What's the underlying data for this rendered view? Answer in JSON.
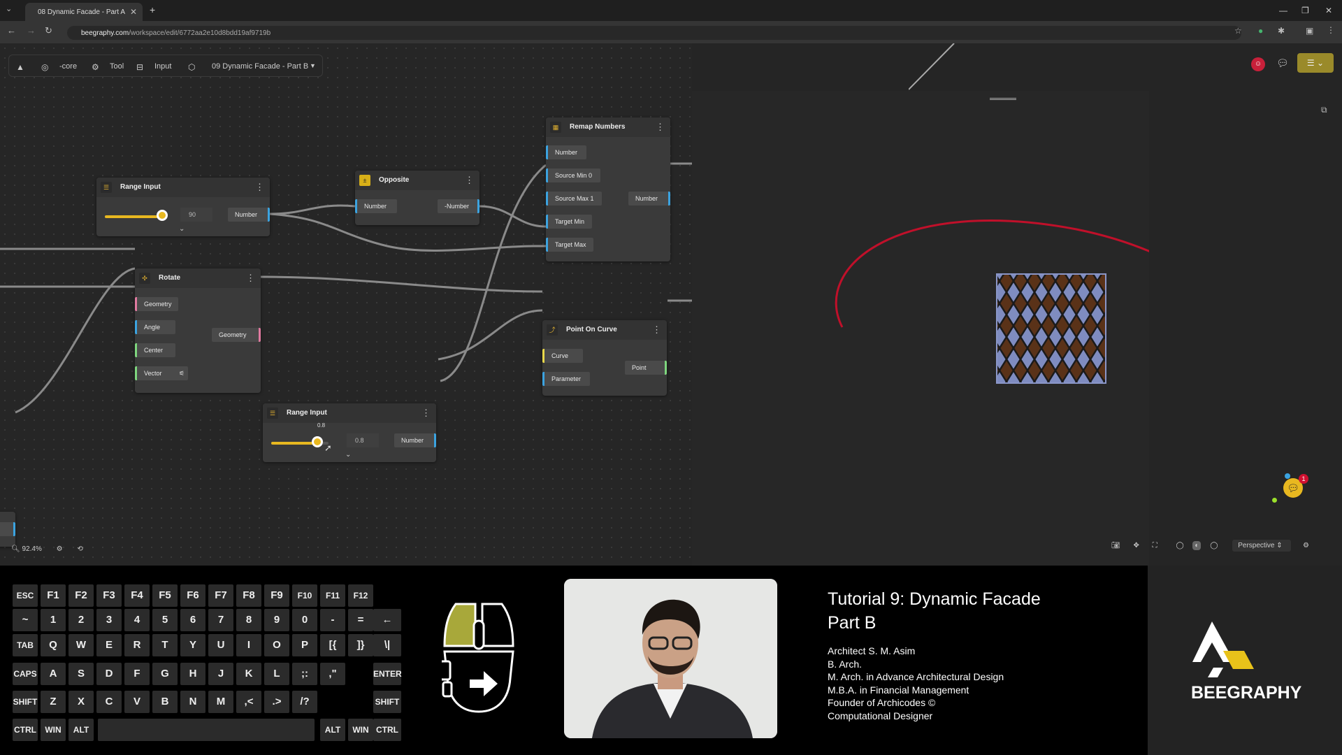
{
  "browser": {
    "tab_title": "08 Dynamic Facade - Part A",
    "url_host": "beegraphy.com",
    "url_path": "/workspace/edit/6772aa2e10d8bdd19af9719b"
  },
  "toolbar": {
    "core_label": "-core",
    "tool_label": "Tool",
    "input_label": "Input",
    "project_label": "09 Dynamic Facade - Part B"
  },
  "nodes": {
    "range_input_1": {
      "title": "Range Input",
      "value": "90",
      "output": "Number"
    },
    "opposite": {
      "title": "Opposite",
      "input": "Number",
      "output": "-Number"
    },
    "remap": {
      "title": "Remap Numbers",
      "inputs": [
        "Number",
        "Source Min",
        "Source Max",
        "Target Min",
        "Target Max"
      ],
      "source_min_val": "0",
      "source_max_val": "1",
      "output": "Number"
    },
    "rotate": {
      "title": "Rotate",
      "inputs": [
        "Geometry",
        "Angle",
        "Center",
        "Vector"
      ],
      "output": "Geometry"
    },
    "point_on_curve": {
      "title": "Point On Curve",
      "inputs": [
        "Curve",
        "Parameter"
      ],
      "output": "Point"
    },
    "range_input_2": {
      "title": "Range Input",
      "tooltip": "0.8",
      "value": "0.8",
      "output": "Number"
    },
    "partial_left": {
      "label": "ber"
    }
  },
  "slider_levels": {
    "range_input_1": 1.0,
    "range_input_2": 0.8
  },
  "zoom": "92.4%",
  "viewport": {
    "view_mode": "Perspective",
    "notification_count": "1"
  },
  "keyboard": {
    "rows": [
      [
        "ESC",
        "F1",
        "F2",
        "F3",
        "F4",
        "F5",
        "F6",
        "F7",
        "F8",
        "F9",
        "F10",
        "F11",
        "F12"
      ],
      [
        "~",
        "1",
        "2",
        "3",
        "4",
        "5",
        "6",
        "7",
        "8",
        "9",
        "0",
        "-",
        "=",
        "←"
      ],
      [
        "TAB",
        "Q",
        "W",
        "E",
        "R",
        "T",
        "Y",
        "U",
        "I",
        "O",
        "P",
        "[{",
        "]}",
        "\\|"
      ],
      [
        "CAPS",
        "A",
        "S",
        "D",
        "F",
        "G",
        "H",
        "J",
        "K",
        "L",
        ";:",
        ",\"",
        "ENTER"
      ],
      [
        "SHIFT",
        "Z",
        "X",
        "C",
        "V",
        "B",
        "N",
        "M",
        ",<",
        ".>",
        "/?",
        "SHIFT"
      ],
      [
        "CTRL",
        "WIN",
        "ALT",
        "ALT",
        "WIN",
        "CTRL"
      ]
    ]
  },
  "tutorial": {
    "title_line1": "Tutorial 9: Dynamic Facade",
    "title_line2": "Part B",
    "credits": [
      "Architect S. M. Asim",
      "B. Arch.",
      "M. Arch. in Advance Architectural Design",
      "M.B.A. in Financial Management",
      "Founder of Archicodes ©",
      "Computational Designer"
    ]
  },
  "brand": {
    "name": "BEEGRAPHY"
  },
  "colors": {
    "accent": "#e8b820",
    "port_blue": "#3ba3e0",
    "port_pink": "#e07aa0",
    "port_green": "#7ed67e",
    "curve_red": "#c0102a"
  }
}
